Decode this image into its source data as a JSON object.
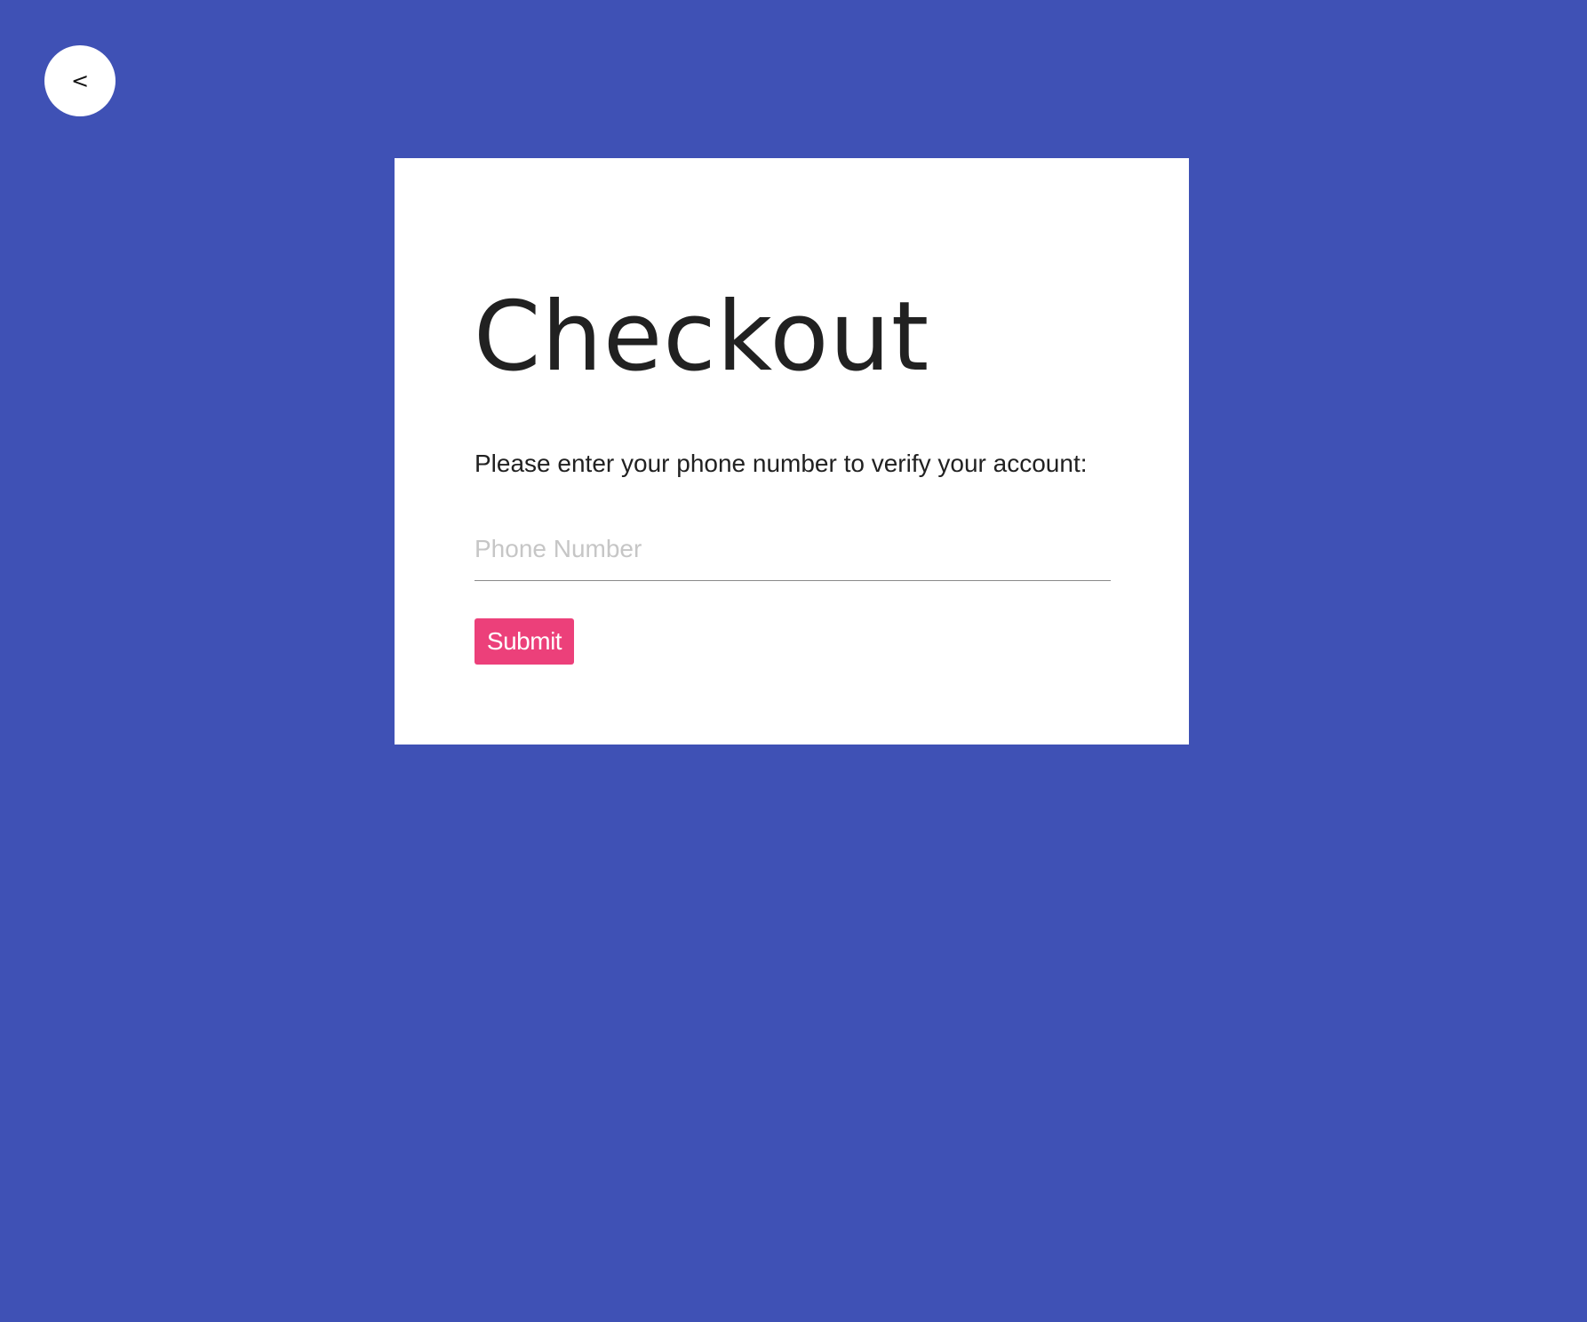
{
  "colors": {
    "background": "#3f51b5",
    "card": "#ffffff",
    "accent": "#ec407a",
    "text": "#212121",
    "placeholder": "#c6c6c6"
  },
  "nav": {
    "back_label": "<",
    "back_icon": "chevron-left-icon"
  },
  "checkout": {
    "title": "Checkout",
    "instructions": "Please enter your phone number to verify your account:",
    "phone": {
      "value": "",
      "placeholder": "Phone Number"
    },
    "submit_label": "Submit"
  }
}
